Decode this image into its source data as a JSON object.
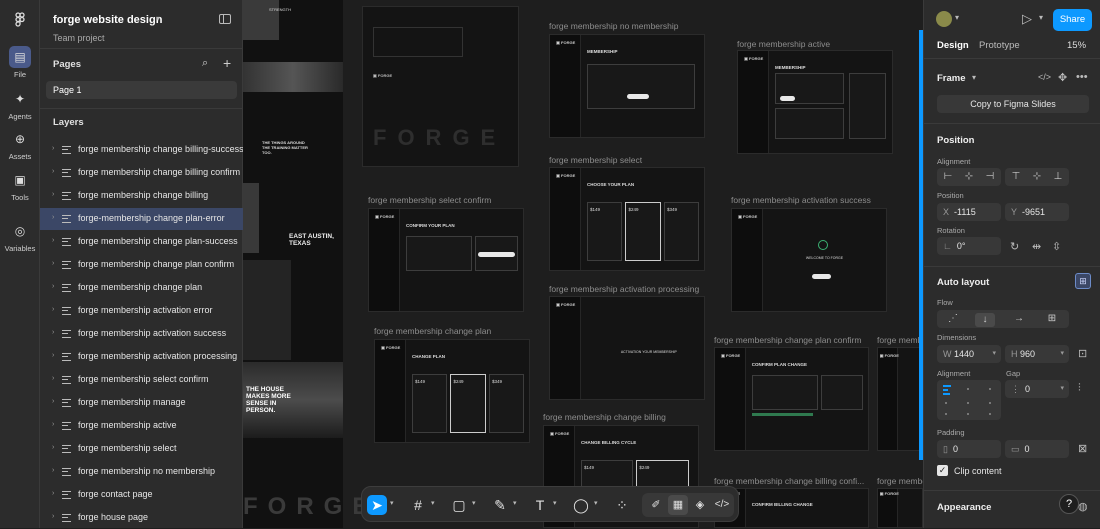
{
  "app": {
    "file_title": "forge website design",
    "team": "Team project",
    "rail": [
      {
        "label": "File",
        "icon": "file-icon"
      },
      {
        "label": "Agents",
        "icon": "agents-icon"
      },
      {
        "label": "Assets",
        "icon": "assets-icon"
      },
      {
        "label": "Tools",
        "icon": "tools-icon"
      },
      {
        "label": "Variables",
        "icon": "variables-icon"
      }
    ]
  },
  "pages": {
    "heading": "Pages",
    "current": "Page 1"
  },
  "layers": {
    "heading": "Layers",
    "items": [
      "forge membership change billing-success",
      "forge membership change billing confirm",
      "forge membership change billing",
      "forge-membership change plan-error",
      "forge membership change plan-success",
      "forge membership change plan confirm",
      "forge membership change plan",
      "forge membership activation error",
      "forge membership activation success",
      "forge membership activation processing",
      "forge membership select confirm",
      "forge membership manage",
      "forge membership active",
      "forge membership select",
      "forge membership no membership",
      "forge contact page",
      "forge house page"
    ],
    "selected_index": 3
  },
  "canvas": {
    "frames": [
      "forge membership no membership",
      "forge membership active",
      "forge membership select",
      "forge membership select confirm",
      "forge membership activation success",
      "forge membership activation processing",
      "forge membership change plan",
      "forge membership change plan confirm",
      "forge membership change billing",
      "forge membership change billing confi..."
    ],
    "clipped_labels": [
      "forge membe",
      "forge membe"
    ],
    "texts": {
      "forge_big": "FORGE",
      "welcome": "WELCOME TO FORGE",
      "activation_prog": "ACTIVATION YOUR MEMBERSHIP",
      "change_plan": "CHANGE PLAN",
      "choose_plan": "CHOOSE YOUR PLAN",
      "confirm_plan": "CONFIRM YOUR PLAN",
      "confirm_change": "CONFIRM PLAN CHANGE",
      "billing_cycle": "CHANGE BILLING CYCLE",
      "confirm_billing": "CONFIRM BILLING CHANGE",
      "membership": "MEMBERSHIP",
      "east_austin": "EAST AUSTIN, TEXAS",
      "house_makes": "THE HOUSE MAKES MORE SENSE IN PERSON.",
      "things": "THE THINGS AROUND THE TRAINING MATTER TOO.",
      "strength": "STRENGTH",
      "price1": "$149",
      "price2": "$249",
      "price3": "$349"
    }
  },
  "toolbar": {
    "tools": [
      "move-tool",
      "frame-tool",
      "shape-tool",
      "pen-tool",
      "text-tool",
      "comment-tool",
      "actions-tool",
      "draw-toggle",
      "design-toggle",
      "prototype-toggle",
      "dev-mode-toggle"
    ]
  },
  "right": {
    "share": "Share",
    "tab_design": "Design",
    "tab_prototype": "Prototype",
    "zoom": "15%",
    "frame_label": "Frame",
    "copy_slides": "Copy to Figma Slides",
    "position": {
      "heading": "Position",
      "alignment": "Alignment",
      "position_label": "Position",
      "x_label": "X",
      "x": "-1115",
      "y_label": "Y",
      "y": "-9651",
      "rotation_label": "Rotation",
      "rotation": "0°"
    },
    "auto_layout": {
      "heading": "Auto layout",
      "flow": "Flow",
      "dimensions": "Dimensions",
      "w_label": "W",
      "w": "1440",
      "h_label": "H",
      "h": "960",
      "alignment": "Alignment",
      "gap": "Gap",
      "gap_value": "0",
      "padding": "Padding",
      "pad_h": "0",
      "pad_v": "0",
      "clip": "Clip content"
    },
    "appearance": {
      "heading": "Appearance"
    },
    "help": "?"
  },
  "colors": {
    "accent": "#0d99ff",
    "selection": "#3b4766",
    "panel": "#2c2c2c",
    "canvas": "#1e1e1e"
  }
}
